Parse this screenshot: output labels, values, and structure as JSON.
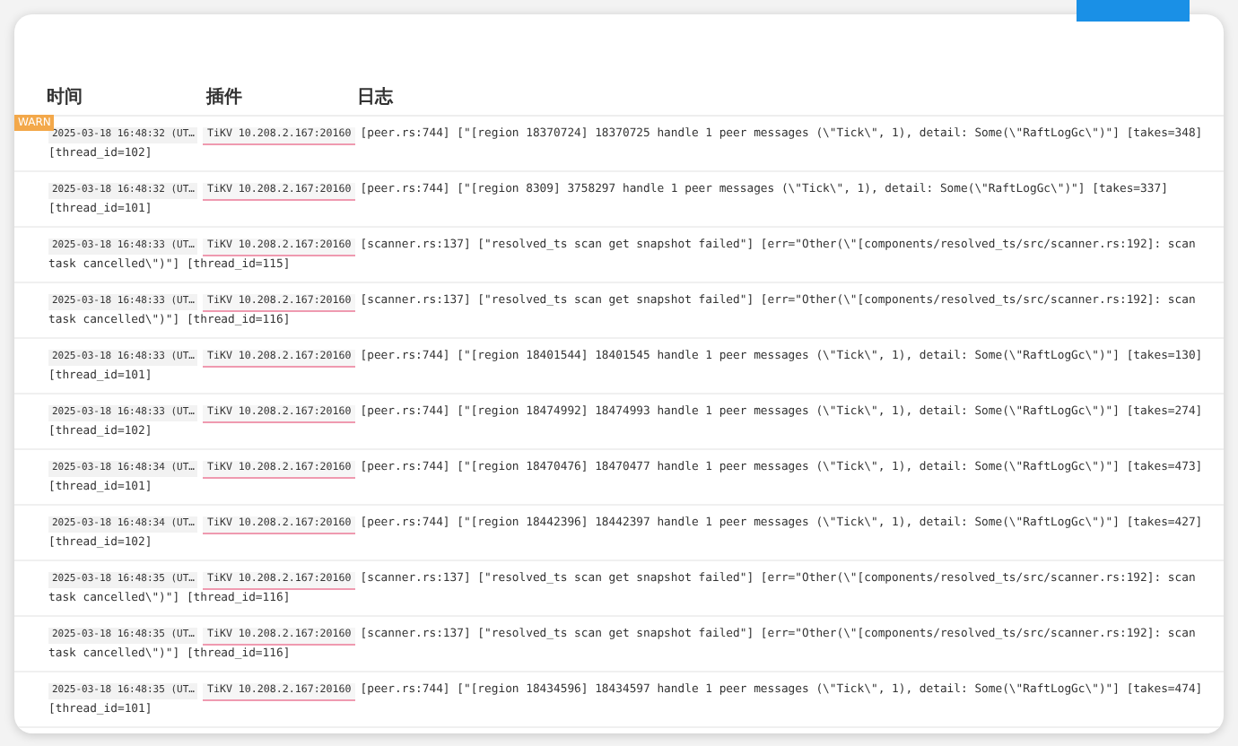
{
  "table": {
    "columns": [
      "时间",
      "插件",
      "日志"
    ],
    "rows": [
      {
        "badge": "WARN",
        "time": "2025-03-18 16:48:32 (UT…",
        "instance": "TiKV 10.208.2.167:20160",
        "message": [
          "[peer.rs:744] [\"[region 18370724] 18370725 handle 1 peer messages (\\\"Tick\\\", 1), detail: Some(\\\"RaftLogGc\\\")\"] [takes=348]",
          "[thread_id=102]"
        ]
      },
      {
        "time": "2025-03-18 16:48:32 (UT…",
        "instance": "TiKV 10.208.2.167:20160",
        "message": [
          "[peer.rs:744] [\"[region 8309] 3758297 handle 1 peer messages (\\\"Tick\\\", 1), detail: Some(\\\"RaftLogGc\\\")\"] [takes=337]",
          "[thread_id=101]"
        ]
      },
      {
        "time": "2025-03-18 16:48:33 (UT…",
        "instance": "TiKV 10.208.2.167:20160",
        "message": [
          "[scanner.rs:137] [\"resolved_ts scan get snapshot failed\"] [err=\"Other(\\\"[components/resolved_ts/src/scanner.rs:192]: scan",
          "task cancelled\\\")\"] [thread_id=115]"
        ]
      },
      {
        "time": "2025-03-18 16:48:33 (UT…",
        "instance": "TiKV 10.208.2.167:20160",
        "message": [
          "[scanner.rs:137] [\"resolved_ts scan get snapshot failed\"] [err=\"Other(\\\"[components/resolved_ts/src/scanner.rs:192]: scan",
          "task cancelled\\\")\"] [thread_id=116]"
        ]
      },
      {
        "time": "2025-03-18 16:48:33 (UT…",
        "instance": "TiKV 10.208.2.167:20160",
        "message": [
          "[peer.rs:744] [\"[region 18401544] 18401545 handle 1 peer messages (\\\"Tick\\\", 1), detail: Some(\\\"RaftLogGc\\\")\"] [takes=130]",
          "[thread_id=101]"
        ]
      },
      {
        "time": "2025-03-18 16:48:33 (UT…",
        "instance": "TiKV 10.208.2.167:20160",
        "message": [
          "[peer.rs:744] [\"[region 18474992] 18474993 handle 1 peer messages (\\\"Tick\\\", 1), detail: Some(\\\"RaftLogGc\\\")\"] [takes=274]",
          "[thread_id=102]"
        ]
      },
      {
        "time": "2025-03-18 16:48:34 (UT…",
        "instance": "TiKV 10.208.2.167:20160",
        "message": [
          "[peer.rs:744] [\"[region 18470476] 18470477 handle 1 peer messages (\\\"Tick\\\", 1), detail: Some(\\\"RaftLogGc\\\")\"] [takes=473]",
          "[thread_id=101]"
        ]
      },
      {
        "time": "2025-03-18 16:48:34 (UT…",
        "instance": "TiKV 10.208.2.167:20160",
        "message": [
          "[peer.rs:744] [\"[region 18442396] 18442397 handle 1 peer messages (\\\"Tick\\\", 1), detail: Some(\\\"RaftLogGc\\\")\"] [takes=427]",
          "[thread_id=102]"
        ]
      },
      {
        "time": "2025-03-18 16:48:35 (UT…",
        "instance": "TiKV 10.208.2.167:20160",
        "message": [
          "[scanner.rs:137] [\"resolved_ts scan get snapshot failed\"] [err=\"Other(\\\"[components/resolved_ts/src/scanner.rs:192]: scan",
          "task cancelled\\\")\"] [thread_id=116]"
        ]
      },
      {
        "time": "2025-03-18 16:48:35 (UT…",
        "instance": "TiKV 10.208.2.167:20160",
        "message": [
          "[scanner.rs:137] [\"resolved_ts scan get snapshot failed\"] [err=\"Other(\\\"[components/resolved_ts/src/scanner.rs:192]: scan",
          "task cancelled\\\")\"] [thread_id=116]"
        ]
      },
      {
        "time": "2025-03-18 16:48:35 (UT…",
        "instance": "TiKV 10.208.2.167:20160",
        "message": [
          "[peer.rs:744] [\"[region 18434596] 18434597 handle 1 peer messages (\\\"Tick\\\", 1), detail: Some(\\\"RaftLogGc\\\")\"] [takes=474]",
          "[thread_id=101]"
        ]
      }
    ]
  }
}
